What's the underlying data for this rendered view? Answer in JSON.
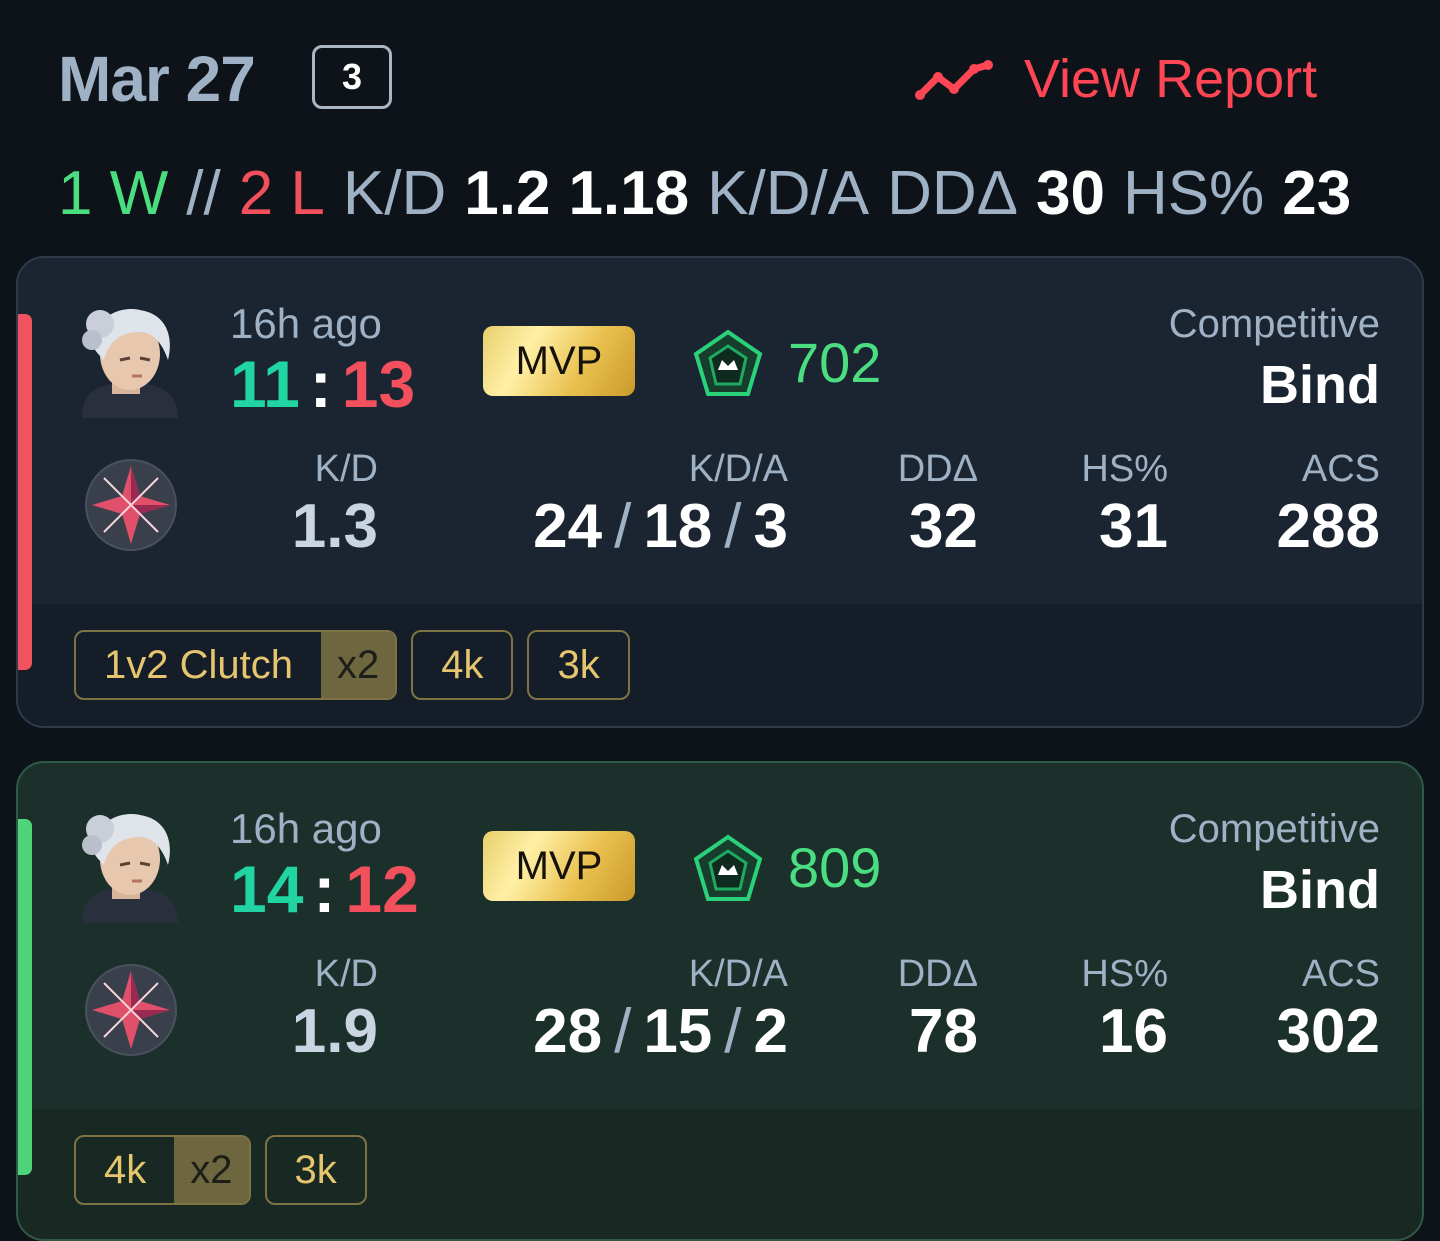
{
  "header": {
    "date": "Mar 27",
    "match_count": "3",
    "view_report_label": "View Report",
    "summary": {
      "wins": "1 W",
      "separator": "//",
      "losses": "2 L",
      "kd_label": "K/D",
      "kd_value": "1.2",
      "kda_value": "1.18",
      "kda_label": "K/D/A",
      "dda_label": "DDΔ",
      "dda_value": "30",
      "hs_label": "HS%",
      "hs_value": "23"
    }
  },
  "matches": [
    {
      "result": "loss",
      "time_ago": "16h ago",
      "score_own": "11",
      "score_sep": ":",
      "score_enemy": "13",
      "badge": "MVP",
      "rank_rating": "702",
      "mode": "Competitive",
      "map": "Bind",
      "stats": {
        "kd_label": "K/D",
        "kd": "1.3",
        "kda_label": "K/D/A",
        "kills": "24",
        "deaths": "18",
        "assists": "3",
        "dda_label": "DDΔ",
        "dda": "32",
        "hs_label": "HS%",
        "hs": "31",
        "acs_label": "ACS",
        "acs": "288"
      },
      "tags": [
        {
          "label": "1v2 Clutch",
          "multiplier": "x2"
        },
        {
          "label": "4k",
          "multiplier": ""
        },
        {
          "label": "3k",
          "multiplier": ""
        }
      ]
    },
    {
      "result": "win",
      "time_ago": "16h ago",
      "score_own": "14",
      "score_sep": ":",
      "score_enemy": "12",
      "badge": "MVP",
      "rank_rating": "809",
      "mode": "Competitive",
      "map": "Bind",
      "stats": {
        "kd_label": "K/D",
        "kd": "1.9",
        "kda_label": "K/D/A",
        "kills": "28",
        "deaths": "15",
        "assists": "2",
        "dda_label": "DDΔ",
        "dda": "78",
        "hs_label": "HS%",
        "hs": "16",
        "acs_label": "ACS",
        "acs": "302"
      },
      "tags": [
        {
          "label": "4k",
          "multiplier": "x2"
        },
        {
          "label": "3k",
          "multiplier": ""
        }
      ]
    }
  ],
  "colors": {
    "accent_red": "#ff4655",
    "win_green": "#4ade80",
    "score_teal": "#21d5a2",
    "mvp_gold": "#e8cf6c",
    "tag_gold": "#e5c56e"
  },
  "icons": {
    "report": "trend-line-icon",
    "agent": "agent-portrait-icon",
    "ability": "ability-star-icon",
    "rank": "rank-emblem-icon"
  }
}
